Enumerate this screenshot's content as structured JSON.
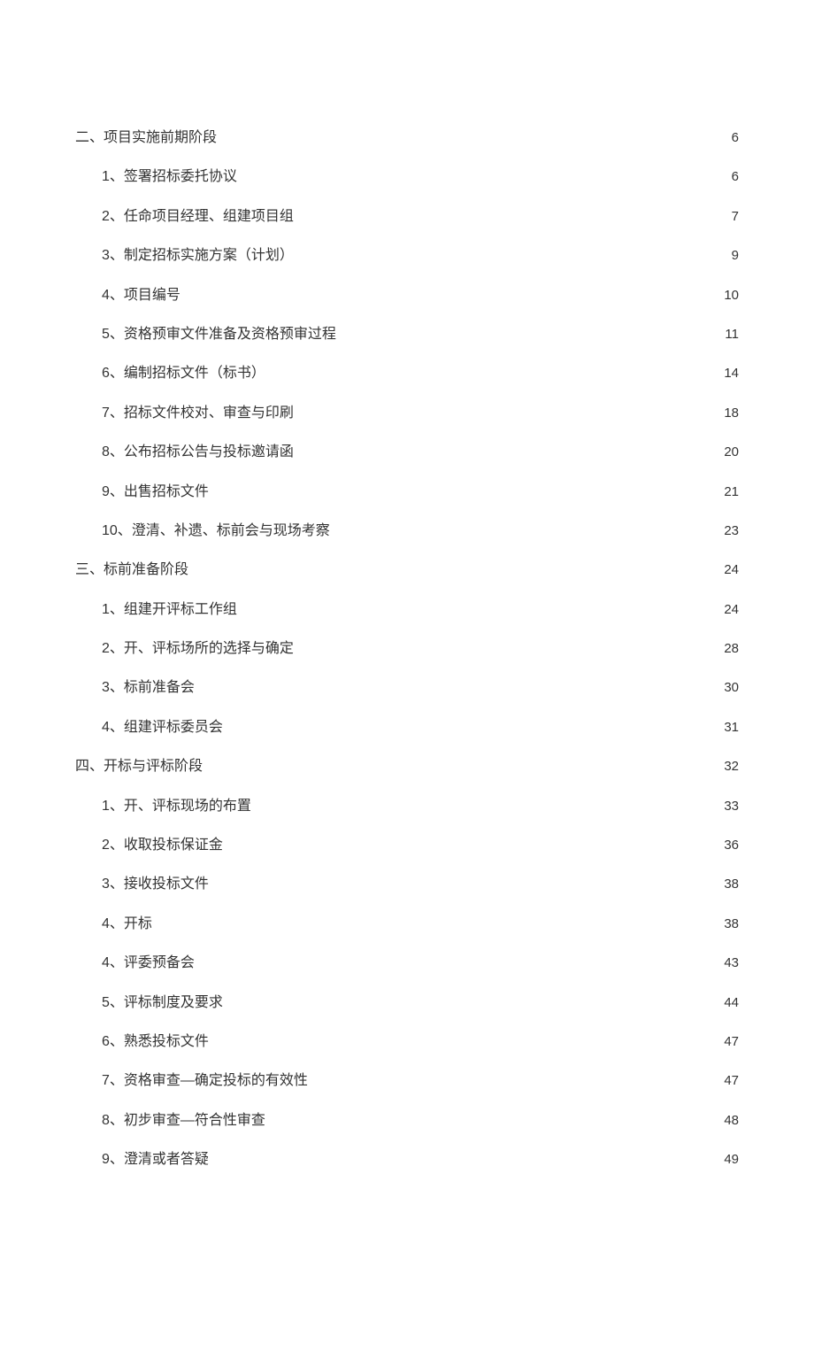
{
  "toc": [
    {
      "label": "二、项目实施前期阶段",
      "page": "6",
      "items": [
        {
          "label": "1、签署招标委托协议",
          "page": "6"
        },
        {
          "label": "2、任命项目经理、组建项目组",
          "page": "7"
        },
        {
          "label": "3、制定招标实施方案（计划）",
          "page": "9"
        },
        {
          "label": "4、项目编号",
          "page": "10"
        },
        {
          "label": "5、资格预审文件准备及资格预审过程",
          "page": "11"
        },
        {
          "label": "6、编制招标文件（标书）",
          "page": "14"
        },
        {
          "label": "7、招标文件校对、审查与印刷",
          "page": "18"
        },
        {
          "label": "8、公布招标公告与投标邀请函",
          "page": "20"
        },
        {
          "label": "9、出售招标文件",
          "page": "21"
        },
        {
          "label": "10、澄清、补遗、标前会与现场考察",
          "page": "23"
        }
      ]
    },
    {
      "label": "三、标前准备阶段",
      "page": "24",
      "items": [
        {
          "label": "1、组建开评标工作组",
          "page": "24"
        },
        {
          "label": "2、开、评标场所的选择与确定",
          "page": "28"
        },
        {
          "label": "3、标前准备会",
          "page": "30"
        },
        {
          "label": "4、组建评标委员会",
          "page": "31"
        }
      ]
    },
    {
      "label": "四、开标与评标阶段",
      "page": "32",
      "items": [
        {
          "label": "1、开、评标现场的布置",
          "page": "33"
        },
        {
          "label": "2、收取投标保证金",
          "page": "36"
        },
        {
          "label": "3、接收投标文件",
          "page": "38"
        },
        {
          "label": "4、开标",
          "page": "38"
        },
        {
          "label": "4、评委预备会",
          "page": "43"
        },
        {
          "label": "5、评标制度及要求",
          "page": "44"
        },
        {
          "label": "6、熟悉投标文件",
          "page": "47"
        },
        {
          "label": "7、资格审查—确定投标的有效性",
          "page": "47"
        },
        {
          "label": "8、初步审查—符合性审查",
          "page": "48"
        },
        {
          "label": "9、澄清或者答疑",
          "page": "49"
        }
      ]
    }
  ]
}
